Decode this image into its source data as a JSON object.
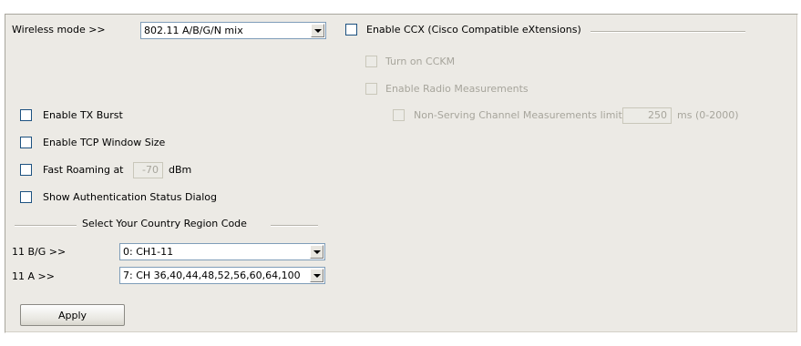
{
  "wireless_mode": {
    "label": "Wireless mode >>",
    "value": "802.11 A/B/G/N mix"
  },
  "ccx": {
    "enable_label": "Enable CCX (Cisco Compatible eXtensions)",
    "turn_on_cckm": "Turn on CCKM",
    "radio_measurements": "Enable Radio Measurements",
    "non_serving_label": "Non-Serving Channel Measurements limit",
    "non_serving_value": "250",
    "non_serving_unit": "ms (0-2000)"
  },
  "options": {
    "tx_burst": "Enable TX Burst",
    "tcp_window": "Enable TCP Window Size",
    "fast_roaming": "Fast Roaming at",
    "fast_roaming_value": "-70",
    "fast_roaming_unit": "dBm",
    "auth_status": "Show Authentication Status Dialog"
  },
  "country_region": {
    "title": "Select Your Country Region Code",
    "bg_label": "11 B/G >>",
    "bg_value": "0: CH1-11",
    "a_label": "11 A >>",
    "a_value": "7: CH 36,40,44,48,52,56,60,64,100"
  },
  "apply_button": "Apply"
}
